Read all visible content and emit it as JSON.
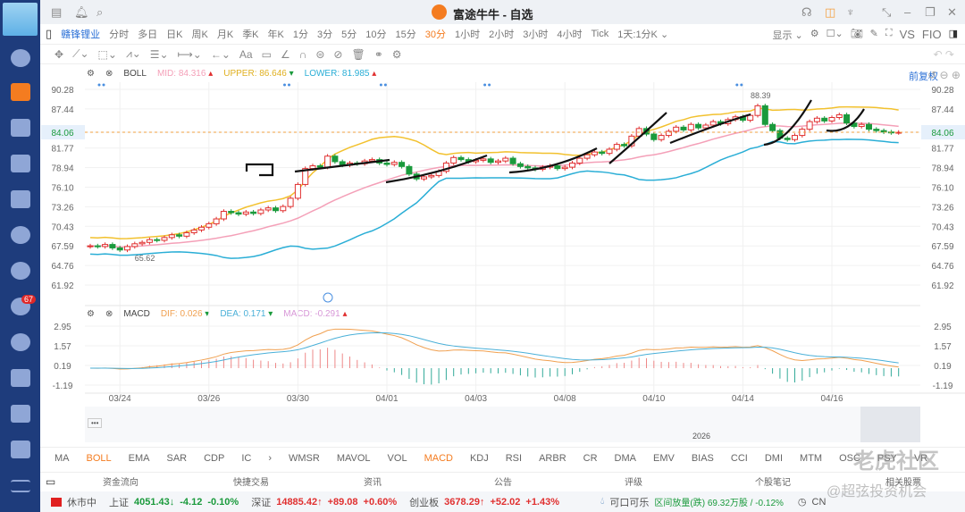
{
  "app": {
    "title": "富途牛牛 - 自选"
  },
  "sidebar": {
    "badge": "67"
  },
  "periods": {
    "stock": "赣锋锂业",
    "items": [
      "分时",
      "多日",
      "日K",
      "周K",
      "月K",
      "季K",
      "年K",
      "1分",
      "3分",
      "5分",
      "10分",
      "15分",
      "30分",
      "1小时",
      "2小时",
      "3小时",
      "4小时",
      "Tick",
      "1天:1分K ⌄"
    ],
    "selected": "30分"
  },
  "toolbar": {
    "show": "显示 ⌄",
    "vs": "VS",
    "fio": "FIO"
  },
  "boll": {
    "name": "BOLL",
    "mid_label": "MID:",
    "mid": "84.316",
    "upper_label": "UPPER:",
    "upper": "86.646",
    "lower_label": "LOWER:",
    "lower": "81.985",
    "fq": "前复权"
  },
  "macd": {
    "name": "MACD",
    "dif_label": "DIF:",
    "dif": "0.026",
    "dea_label": "DEA:",
    "dea": "0.171",
    "macd_label": "MACD:",
    "macd": "-0.291"
  },
  "colors": {
    "up": "#e03030",
    "down": "#1a9a3c",
    "mid": "#f4a0b8",
    "upper": "#f2c12e",
    "lower": "#2aaed6",
    "dif": "#f0a050",
    "dea": "#4ab0d8"
  },
  "chart_data": {
    "type": "candlestick",
    "price_ticks": [
      "90.28",
      "87.44",
      "84.06",
      "81.77",
      "78.94",
      "76.10",
      "73.26",
      "70.43",
      "67.59",
      "64.76",
      "61.92"
    ],
    "ylim": [
      61.92,
      90.28
    ],
    "last_price": 84.06,
    "last_price_label": "84.06",
    "high_label": "88.39",
    "low_label": "65.62",
    "macd_ticks": [
      "2.95",
      "1.57",
      "0.19",
      "-1.19"
    ],
    "macd_ylim": [
      -1.19,
      2.95
    ],
    "dates": [
      "03/24",
      "03/26",
      "03/30",
      "04/01",
      "04/03",
      "04/08",
      "04/10",
      "04/14",
      "04/16"
    ],
    "date_bar_index": [
      4,
      16,
      28,
      40,
      52,
      64,
      76,
      88,
      100
    ],
    "nav_year": "2026",
    "closes": [
      67.6,
      67.5,
      67.8,
      67.3,
      67.0,
      67.5,
      67.9,
      68.1,
      68.5,
      68.4,
      68.8,
      69.2,
      69.0,
      69.5,
      69.9,
      70.3,
      70.8,
      71.5,
      72.6,
      72.4,
      72.2,
      72.5,
      72.3,
      72.8,
      73.1,
      72.7,
      73.3,
      74.5,
      76.5,
      78.8,
      79.2,
      79.0,
      80.6,
      79.8,
      79.3,
      79.6,
      79.5,
      79.9,
      80.1,
      79.6,
      79.4,
      79.7,
      79.1,
      78.0,
      77.3,
      77.6,
      77.8,
      78.4,
      79.6,
      80.4,
      80.1,
      79.8,
      80.0,
      80.2,
      79.7,
      79.9,
      80.3,
      79.5,
      79.1,
      78.9,
      78.7,
      79.0,
      79.2,
      78.8,
      79.0,
      79.6,
      80.3,
      80.8,
      81.2,
      81.0,
      81.6,
      82.3,
      82.1,
      83.5,
      84.6,
      83.8,
      83.0,
      83.6,
      84.2,
      84.8,
      84.4,
      85.2,
      84.7,
      85.1,
      85.6,
      85.3,
      85.9,
      86.3,
      85.8,
      86.5,
      87.9,
      85.2,
      84.3,
      83.2,
      83.0,
      83.6,
      84.5,
      85.6,
      86.1,
      85.7,
      86.2,
      86.6,
      85.4,
      84.9,
      85.2,
      84.5,
      84.3,
      84.1,
      84.0,
      84.06
    ]
  },
  "indicators": {
    "items": [
      "MA",
      "BOLL",
      "EMA",
      "SAR",
      "CDP",
      "IC",
      "›",
      "WMSR",
      "MAVOL",
      "VOL",
      "MACD",
      "KDJ",
      "RSI",
      "ARBR",
      "CR",
      "DMA",
      "EMV",
      "BIAS",
      "CCI",
      "DMI",
      "MTM",
      "OSC",
      "PSY",
      "VR"
    ],
    "active": [
      "BOLL",
      "MACD"
    ]
  },
  "bottom_tabs": [
    "资金流向",
    "快捷交易",
    "资讯",
    "公告",
    "评级",
    "个股笔记",
    "相关股票"
  ],
  "status": {
    "market": "休市中",
    "sh_label": "上证",
    "sh": "4051.43↓",
    "sh_chg": "-4.12",
    "sh_pct": "-0.10%",
    "sz_label": "深证",
    "sz": "14885.42↑",
    "sz_chg": "+89.08",
    "sz_pct": "+0.60%",
    "cy_label": "创业板",
    "cy": "3678.29↑",
    "cy_chg": "+52.02",
    "cy_pct": "+1.43%",
    "news_title": "可口可乐",
    "news": "区间放量(跌) 69.32万股 / -0.12%",
    "cn": "CN"
  },
  "watermark": "老虎社区",
  "watermark2": "@超弦投资机会"
}
